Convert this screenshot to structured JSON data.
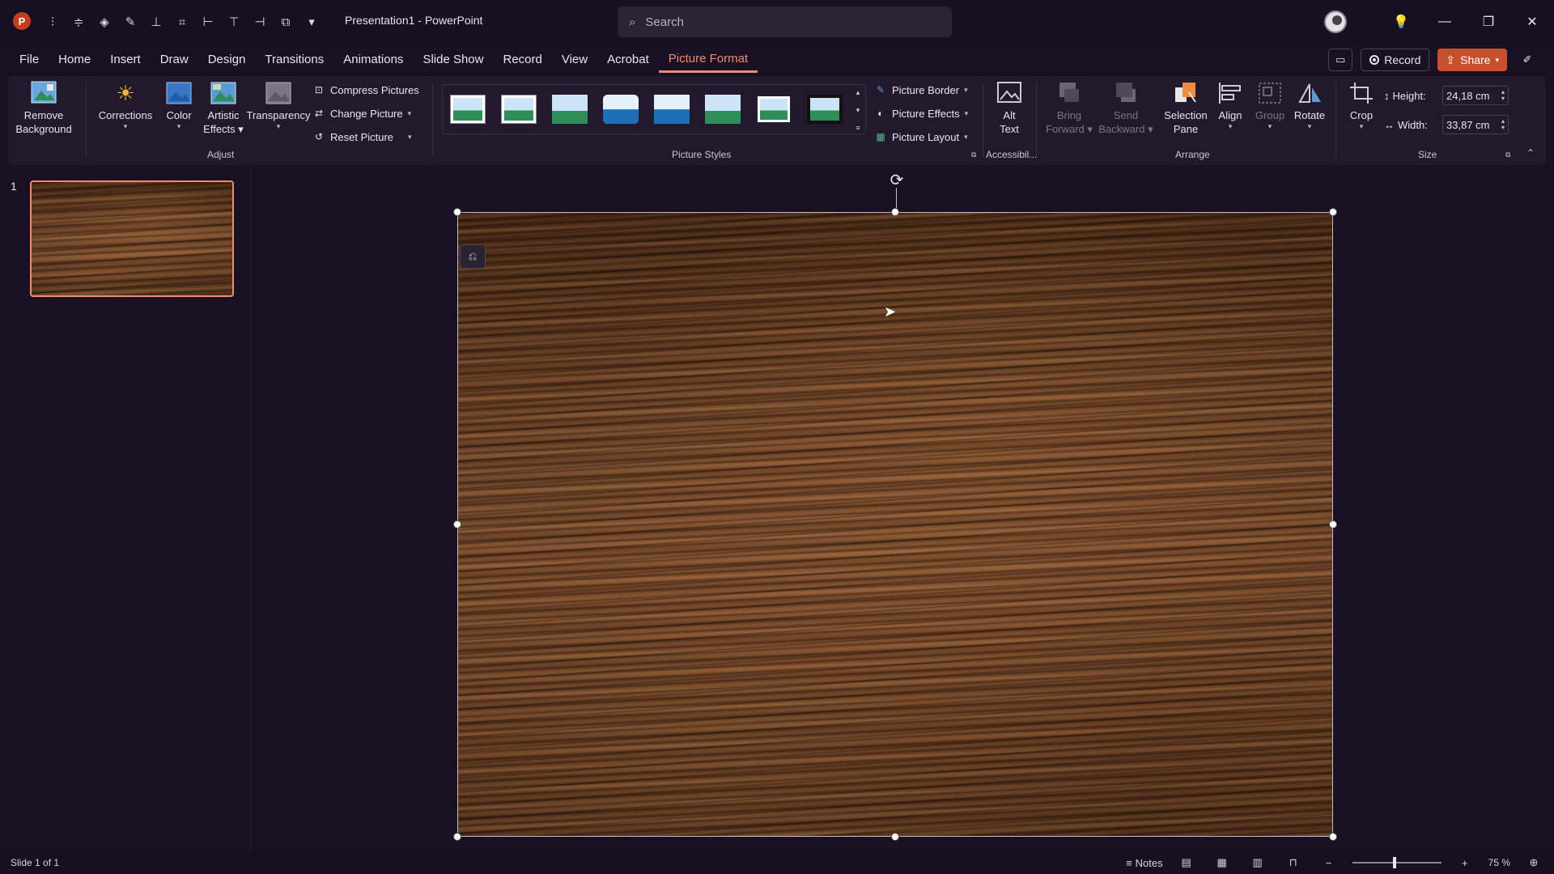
{
  "app": {
    "logo_letter": "P",
    "title": "Presentation1  -  PowerPoint"
  },
  "search": {
    "placeholder": "Search"
  },
  "tabs": [
    {
      "label": "File"
    },
    {
      "label": "Home"
    },
    {
      "label": "Insert"
    },
    {
      "label": "Draw"
    },
    {
      "label": "Design"
    },
    {
      "label": "Transitions"
    },
    {
      "label": "Animations"
    },
    {
      "label": "Slide Show"
    },
    {
      "label": "Record"
    },
    {
      "label": "View"
    },
    {
      "label": "Acrobat"
    },
    {
      "label": "Picture Format"
    }
  ],
  "active_tab": "Picture Format",
  "top_right": {
    "record_label": "Record",
    "share_label": "Share"
  },
  "ribbon": {
    "adjust": {
      "group_label": "Adjust",
      "remove_background": "Remove Background",
      "remove_background_l1": "Remove",
      "remove_background_l2": "Background",
      "corrections": "Corrections",
      "color": "Color",
      "artistic_l1": "Artistic",
      "artistic_l2": "Effects",
      "transparency": "Transparency",
      "compress": "Compress Pictures",
      "change": "Change Picture",
      "reset": "Reset Picture"
    },
    "picture_styles": {
      "group_label": "Picture Styles",
      "border": "Picture Border",
      "effects": "Picture Effects",
      "layout": "Picture Layout"
    },
    "accessibility": {
      "group_label": "Accessibil...",
      "alt_l1": "Alt",
      "alt_l2": "Text"
    },
    "arrange": {
      "group_label": "Arrange",
      "bring_l1": "Bring",
      "bring_l2": "Forward",
      "send_l1": "Send",
      "send_l2": "Backward",
      "selection_l1": "Selection",
      "selection_l2": "Pane",
      "align": "Align",
      "group": "Group",
      "rotate": "Rotate"
    },
    "size": {
      "group_label": "Size",
      "crop": "Crop",
      "height_label": "Height:",
      "height_value": "24,18 cm",
      "width_label": "Width:",
      "width_value": "33,87 cm"
    }
  },
  "thumbnails": [
    {
      "number": "1"
    }
  ],
  "status": {
    "slide_count": "Slide 1 of 1",
    "notes": "Notes",
    "zoom": "75 %"
  },
  "colors": {
    "accent": "#f08c6e",
    "share": "#c8502e",
    "background": "#1a1024"
  }
}
